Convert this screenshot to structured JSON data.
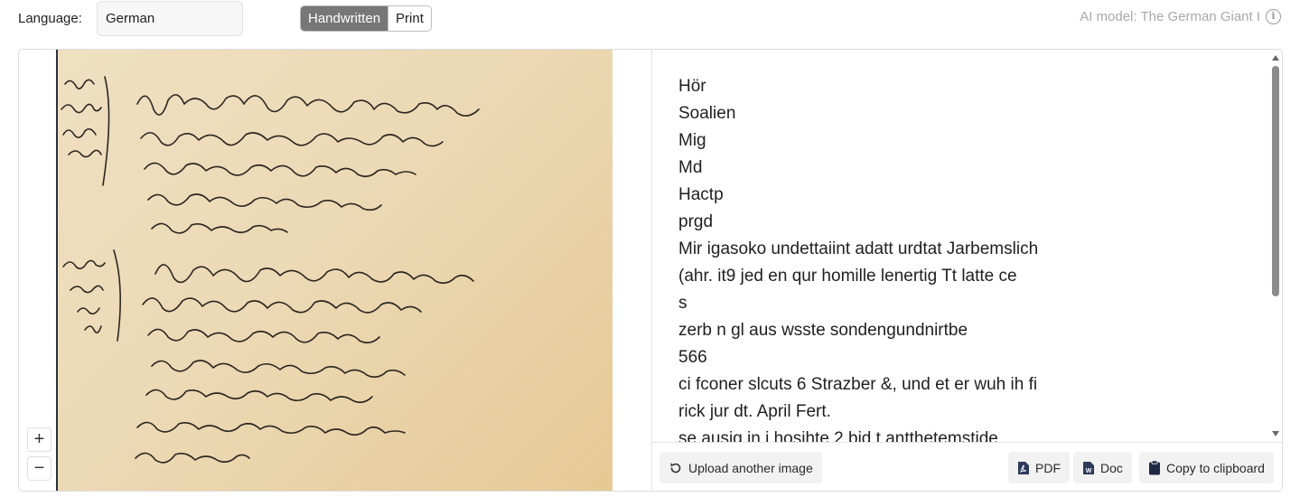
{
  "toolbar": {
    "language_label": "Language:",
    "language_value": "German",
    "mode_options": [
      "Handwritten",
      "Print"
    ],
    "mode_selected": "Handwritten",
    "model_label": "AI model: The German Giant I"
  },
  "viewer": {
    "zoom_in": "+",
    "zoom_out": "−"
  },
  "result": {
    "lines": [
      "Hör",
      "Soalien",
      "Mig",
      "Md",
      "Hactp",
      "prgd",
      "Mir igasoko undettaiint adatt urdtat Jarbemslich",
      "(ahr. it9 jed en qur homille lenertig Tt latte ce",
      "s",
      "zerb n gl aus wsste sondengundnirtbe",
      "566",
      "ci fconer slcuts 6 Strazber &, und et er wuh ih fi",
      "rick jur dt. April Fert.",
      "se ausig in i hosihte 2 bid t antthetemstide"
    ]
  },
  "actions": {
    "upload_label": "Upload another image",
    "pdf_label": "PDF",
    "doc_label": "Doc",
    "copy_label": "Copy to clipboard"
  }
}
